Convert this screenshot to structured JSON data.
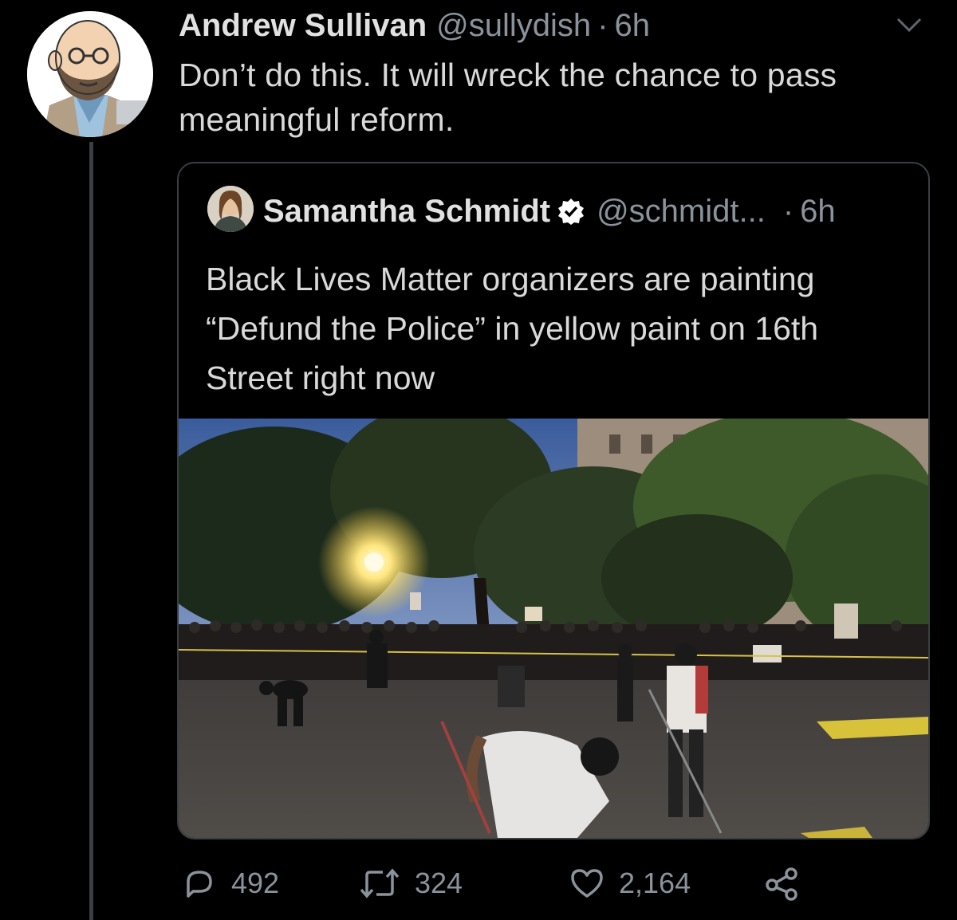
{
  "tweet": {
    "author_name": "Andrew Sullivan",
    "author_handle": "@sullydish",
    "separator": "·",
    "time": "6h",
    "text": "Don’t do this. It will wreck the chance to pass meaningful reform.",
    "avatar_icon": "cartoon-avatar-icon",
    "more_icon": "chevron-down-icon"
  },
  "quoted_tweet": {
    "author_name": "Samantha Schmidt",
    "verified_icon": "verified-badge-icon",
    "author_handle": "@schmidt...",
    "separator": "·",
    "time": "6h",
    "text": "Black Lives Matter organizers are painting “Defund the Police” in yellow paint on 16th Street right now",
    "media_icon": "street-protest-photo"
  },
  "actions": {
    "reply_count": "492",
    "retweet_count": "324",
    "like_count": "2,164",
    "reply_icon": "reply-icon",
    "retweet_icon": "retweet-icon",
    "like_icon": "heart-icon",
    "share_icon": "share-icon"
  },
  "colors": {
    "background": "#000000",
    "text": "#d9d9d9",
    "muted": "#8a939b",
    "border": "#3a3f44",
    "verified": "#ffffff"
  }
}
